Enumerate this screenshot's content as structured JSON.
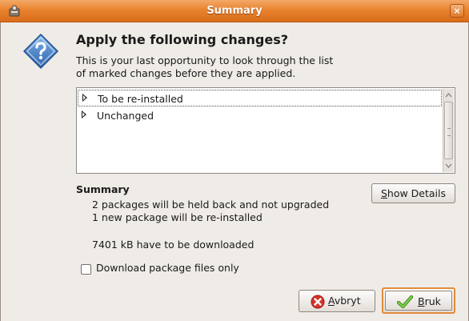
{
  "window": {
    "title": "Summary",
    "close_glyph": "×",
    "app_icon": "package-manager-icon",
    "close_icon": "close-icon"
  },
  "dialog": {
    "icon": "question-icon",
    "heading": "Apply the following changes?",
    "description_line1": "This is your last opportunity to look through the list",
    "description_line2": "of marked changes before they are applied."
  },
  "changes_tree": {
    "rows": [
      {
        "label": "To be re-installed",
        "expanded": false,
        "focused": true
      },
      {
        "label": "Unchanged",
        "expanded": false,
        "focused": false
      }
    ]
  },
  "summary": {
    "label": "Summary",
    "lines": [
      "2 packages will be held back and not upgraded",
      "1 new package will be re-installed",
      "7401 kB have to be downloaded"
    ],
    "show_details_mnemonic": "S",
    "show_details_rest": "how Details"
  },
  "options": {
    "download_only_label": "Download package files only",
    "download_only_checked": false
  },
  "buttons": {
    "cancel_mnemonic": "A",
    "cancel_rest": "vbryt",
    "cancel_icon": "cancel-icon",
    "apply_mnemonic": "B",
    "apply_rest": "ruk",
    "apply_icon": "checkmark-icon"
  },
  "colors": {
    "titlebar": "#e9832f",
    "window_bg": "#efebe7",
    "focus_ring": "#e08b3a",
    "question_icon": "#3a78c4",
    "cancel_icon": "#d8322a",
    "apply_icon": "#5bb02a"
  }
}
